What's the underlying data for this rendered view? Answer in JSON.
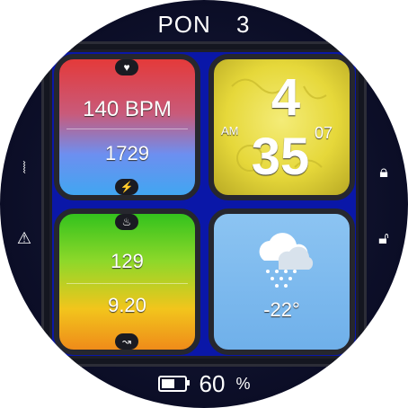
{
  "header": {
    "day": "PON",
    "date": "3"
  },
  "heart_tile": {
    "bpm": "140 BPM",
    "steps": "1729",
    "top_icon": "heart-pulse-icon",
    "bottom_icon": "running-icon"
  },
  "activity_tile": {
    "calories": "129",
    "distance": "9.20",
    "top_icon": "flame-icon",
    "bottom_icon": "distance-icon"
  },
  "time_tile": {
    "hour": "4",
    "minute": "35",
    "ampm": "AM",
    "seconds": "07"
  },
  "weather_tile": {
    "temperature": "-22°",
    "icon": "snow-cloud-icon"
  },
  "side_icons": {
    "left_top": "nfc-icon",
    "left_bottom": "alarm-icon",
    "right_top": "lock-icon",
    "right_bottom": "unlock-icon"
  },
  "battery": {
    "value": "60",
    "unit": "%",
    "icon": "battery-icon"
  },
  "colors": {
    "inner_bg": "#0a17a8",
    "face_bg": "#0b0d26"
  }
}
